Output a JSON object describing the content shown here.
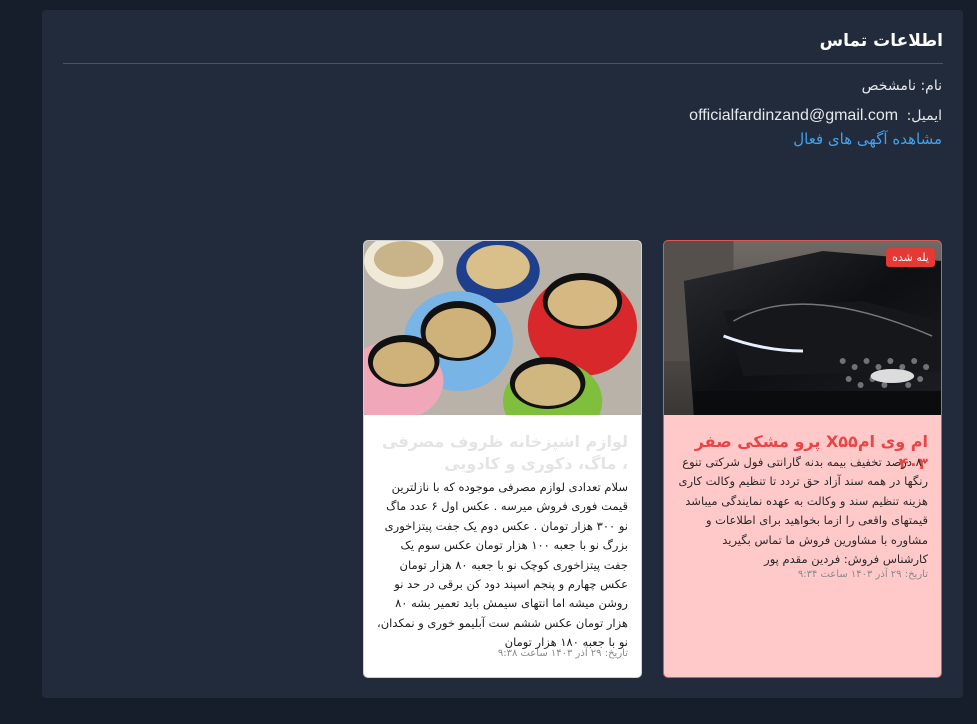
{
  "contact": {
    "title": "اطلاعات تماس",
    "name_label": "نام:",
    "name_value": "نامشخص",
    "email_label": "ایمیل:",
    "email_value": "officialfardinzand@gmail.com",
    "active_ads_link": "مشاهده آگهی های فعال"
  },
  "cards": [
    {
      "badge": "یله شده",
      "title": "ام وی امX۵۵ پرو مشکی صفر ۴۰۳",
      "description": "۸۰ درصد تخفیف بیمه بدنه گارانتی فول شرکتی تنوع رنگها در همه سند آزاد حق تردد تا تنظیم وکالت کاری هزینه تنظیم سند و وکالت به عهده نمایندگی میباشد قیمتهای واقعی را ازما بخواهید برای اطلاعات و مشاوره با مشاورین فروش ما تماس بگیرید کارشناس فروش: فردین مقدم پور",
      "date": "تاریخ: ۲۹ آذر ۱۴۰۳ ساعت ۹:۳۴",
      "image_icon": "black-suv-photo"
    },
    {
      "title": "لوازم اشپزخانه ظروف مصرفی ، ماگ، دکوری و کادویی",
      "description": "سلام تعدادی لوازم مصرفی موجوده که با نازلترین قیمت فوری فروش میرسه . عکس اول ۶ عدد ماگ نو ۳۰۰ هزار تومان . عکس دوم یک جفت پیتزاخوری بزرگ نو با جعبه ۱۰۰ هزار تومان عکس سوم یک جفت پیتزاخوری کوچک نو با جعبه ۸۰ هزار تومان عکس چهارم و پنجم اسپند دود کن برقی در حد نو روشن میشه اما انتهای سیمش باید تعمیر بشه ۸۰ هزار تومان عکس ششم ست آبلیمو خوری و نمکدان، نو با جعبه ۱۸۰ هزار تومان",
      "date": "تاریخ: ۲۹ آذر ۱۴۰۳ ساعت ۹:۳۸",
      "image_icon": "colorful-mugs-photo"
    }
  ],
  "colors": {
    "page_bg": "#161d2b",
    "panel_bg": "#222b3b",
    "link": "#3fa2f0",
    "sold_card_bg": "#ffc9c9",
    "sold_badge": "#e53935"
  }
}
